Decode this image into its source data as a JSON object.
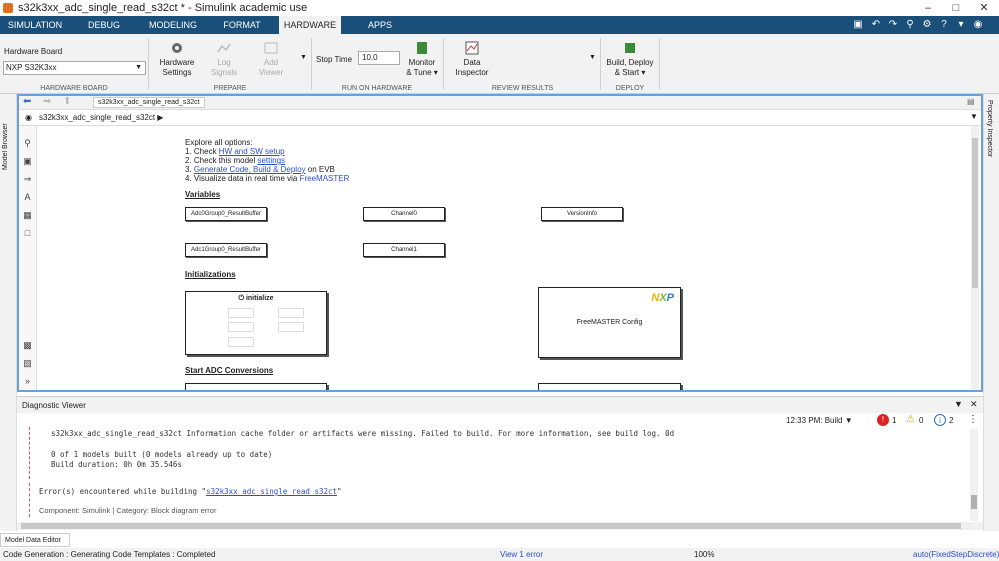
{
  "window": {
    "title": "s32k3xx_adc_single_read_s32ct * - Simulink academic use"
  },
  "tabs": [
    {
      "label": "SIMULATION"
    },
    {
      "label": "DEBUG"
    },
    {
      "label": "MODELING"
    },
    {
      "label": "FORMAT"
    },
    {
      "label": "HARDWARE",
      "active": true
    },
    {
      "label": "APPS"
    }
  ],
  "ribbon": {
    "hardware_board_label": "Hardware Board",
    "hardware_board_value": "NXP S32K3xx",
    "groups": {
      "hardware_board": "HARDWARE BOARD",
      "prepare": "PREPARE",
      "run_on_hardware": "RUN ON HARDWARE",
      "review_results": "REVIEW RESULTS",
      "deploy": "DEPLOY"
    },
    "hardware_settings": [
      "Hardware",
      "Settings"
    ],
    "log_signals": [
      "Log",
      "Signals"
    ],
    "add_viewer": [
      "Add",
      "Viewer"
    ],
    "stop_time_label": "Stop Time",
    "stop_time_value": "10.0",
    "monitor_tune": [
      "Monitor",
      "& Tune"
    ],
    "data_inspector": [
      "Data",
      "Inspector"
    ],
    "build_deploy": [
      "Build, Deploy",
      "& Start"
    ]
  },
  "side_panels": {
    "left": "Model Browser",
    "right": "Property Inspector"
  },
  "editor": {
    "tab_label": "s32k3xx_adc_single_read_s32ct",
    "breadcrumb": "s32k3xx_adc_single_read_s32ct"
  },
  "canvas": {
    "explore_title": "Explore all options:",
    "steps": {
      "s1_prefix": "1. Check ",
      "s1_link": "HW and SW setup",
      "s2_prefix": "2. Check this model ",
      "s2_link": "settings",
      "s3_prefix": "3. ",
      "s3_link": "Generate Code, Build & Deploy",
      "s3_suffix": " on EVB",
      "s4_prefix": "4. Visualize data in real time via ",
      "s4_link": "FreeMASTER"
    },
    "variables_title": "Variables",
    "blocks": {
      "adc0": "Adc0Group0_ResultBuffer",
      "channel0": "Channel0",
      "version": "VersionInfo",
      "adc1": "Adc1Group0_ResultBuffer",
      "channel1": "Channel1"
    },
    "initializations_title": "Initializations",
    "initialize_label": "initialize",
    "freemaster_label": "FreeMASTER Config",
    "nxp_logo": "NXP",
    "start_adc_title": "Start ADC Conversions"
  },
  "diagnostic": {
    "title": "Diagnostic Viewer",
    "time_build": "12:33 PM: Build",
    "error_count": "1",
    "warning_count": "0",
    "info_count": "2",
    "line1": "s32k3xx_adc_single_read_s32ct  Information cache folder or artifacts were missing.  Failed to build. For more information, see build log.  0d",
    "line2": "0 of 1 models built (0 models already up to date)",
    "line3": "Build duration: 0h 0m 35.546s",
    "error_prefix": "Error(s) encountered while building \"",
    "error_link": "s32k3xx_adc_single_read_s32ct",
    "error_suffix": "\"",
    "component": "Component: Simulink | Category: Block diagram error"
  },
  "model_data_editor_tab": "Model Data Editor",
  "status": {
    "left": "Code Generation : Generating Code Templates : Completed",
    "errors": "View 1 error",
    "zoom": "100%",
    "solver": "auto(FixedStepDiscrete)"
  },
  "colors": {
    "tab_bar": "#1a4f7a",
    "accent_blue": "#2a4fd0",
    "error_red": "#d22",
    "editor_border": "#6aa0d8"
  }
}
